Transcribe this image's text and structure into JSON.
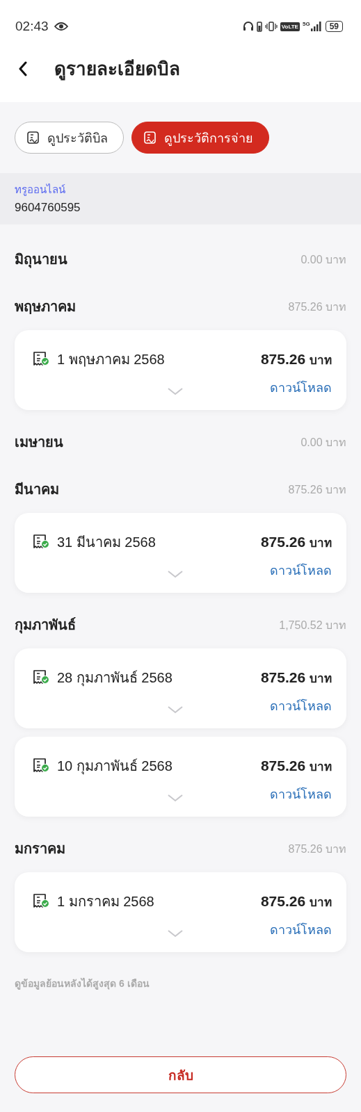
{
  "status_bar": {
    "time": "02:43",
    "volte": "VoLTE",
    "network": "5G",
    "battery": "59"
  },
  "header": {
    "title": "ดูรายละเอียดบิล"
  },
  "tabs": [
    {
      "label": "ดูประวัติบิล",
      "selected": false
    },
    {
      "label": "ดูประวัติการจ่าย",
      "selected": true
    }
  ],
  "account": {
    "name": "ทรูออนไลน์",
    "number": "9604760595"
  },
  "months": [
    {
      "name": "มิถุนายน",
      "total": "0.00 บาท"
    },
    {
      "name": "พฤษภาคม",
      "total": "875.26 บาท",
      "payments": [
        {
          "date": "1 พฤษภาคม 2568",
          "amount": "875.26",
          "unit": "บาท",
          "download": "ดาวน์โหลด",
          "expanded": false
        }
      ]
    },
    {
      "name": "เมษายน",
      "total": "0.00 บาท"
    },
    {
      "name": "มีนาคม",
      "total": "875.26 บาท",
      "payments": [
        {
          "date": "31 มีนาคม 2568",
          "amount": "875.26",
          "unit": "บาท",
          "download": "ดาวน์โหลด",
          "expanded": false
        }
      ]
    },
    {
      "name": "กุมภาพันธ์",
      "total": "1,750.52 บาท",
      "payments": [
        {
          "date": "28 กุมภาพันธ์ 2568",
          "amount": "875.26",
          "unit": "บาท",
          "download": "ดาวน์โหลด",
          "expanded": false
        },
        {
          "date": "10 กุมภาพันธ์ 2568",
          "amount": "875.26",
          "unit": "บาท",
          "download": "ดาวน์โหลด",
          "expanded": false
        }
      ]
    },
    {
      "name": "มกราคม",
      "total": "875.26 บาท",
      "payments": [
        {
          "date": "1 มกราคม 2568",
          "amount": "875.26",
          "unit": "บาท",
          "download": "ดาวน์โหลด",
          "expanded": false
        }
      ]
    }
  ],
  "note": "ดูข้อมูลย้อนหลังได้สูงสุด 6 เดือน",
  "back_button": "กลับ"
}
